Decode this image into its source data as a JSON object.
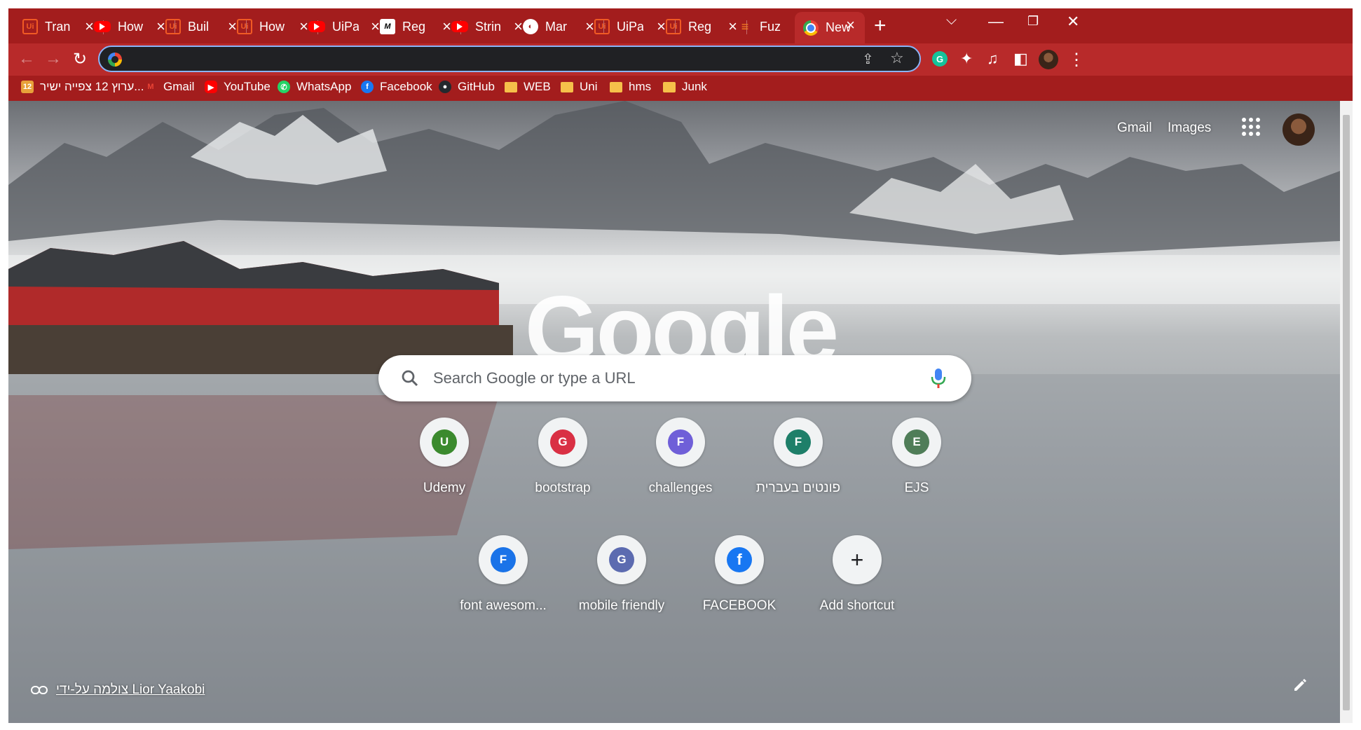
{
  "tabs": [
    {
      "title": "Tran",
      "icon": "uipath-icon",
      "glyph": "Ui"
    },
    {
      "title": "How",
      "icon": "youtube-icon",
      "glyph": ""
    },
    {
      "title": "Buil",
      "icon": "uipath-icon",
      "glyph": "Ui"
    },
    {
      "title": "How",
      "icon": "uipath-icon",
      "glyph": "Ui"
    },
    {
      "title": "UiPa",
      "icon": "youtube-icon",
      "glyph": ""
    },
    {
      "title": "Reg",
      "icon": "medium-icon",
      "glyph": "M"
    },
    {
      "title": "Strin",
      "icon": "youtube-icon",
      "glyph": ""
    },
    {
      "title": "Mar",
      "icon": "globe-icon",
      "glyph": "◐"
    },
    {
      "title": "UiPa",
      "icon": "uipath-icon",
      "glyph": "Ui"
    },
    {
      "title": "Reg",
      "icon": "uipath-icon",
      "glyph": "Ui"
    },
    {
      "title": "Fuz",
      "icon": "stackoverflow-icon",
      "glyph": "≡"
    },
    {
      "title": "New",
      "icon": "chrome-icon",
      "glyph": "",
      "active": true
    }
  ],
  "window": {
    "new_tab": "+",
    "tab_search": "⌵",
    "minimize": "—",
    "restore": "❐",
    "close": "✕"
  },
  "toolbar": {
    "back": "←",
    "forward": "→",
    "reload": "↻",
    "address_value": "",
    "share": "⇪",
    "star": "☆",
    "grammarly": "G",
    "extensions": "✦",
    "media": "♫",
    "sidepanel": "◧",
    "menu": "⋮"
  },
  "bookmarks": [
    {
      "label": "ערוץ 12 צפייה ישיר...",
      "icon": "channel12-icon",
      "glyph": "12",
      "color": "#e8a13a"
    },
    {
      "label": "Gmail",
      "icon": "gmail-icon",
      "glyph": "M",
      "color": "#ea4335"
    },
    {
      "label": "YouTube",
      "icon": "youtube-icon",
      "glyph": "▶",
      "color": "#ff0000"
    },
    {
      "label": "WhatsApp",
      "icon": "whatsapp-icon",
      "glyph": "✆",
      "color": "#25d366"
    },
    {
      "label": "Facebook",
      "icon": "facebook-icon",
      "glyph": "f",
      "color": "#1877f2"
    },
    {
      "label": "GitHub",
      "icon": "github-icon",
      "glyph": "●",
      "color": "#24292e"
    },
    {
      "label": "WEB",
      "icon": "folder-icon",
      "glyph": "",
      "color": "#f6c04a"
    },
    {
      "label": "Uni",
      "icon": "folder-icon",
      "glyph": "",
      "color": "#f6c04a"
    },
    {
      "label": "hms",
      "icon": "folder-icon",
      "glyph": "",
      "color": "#f6c04a"
    },
    {
      "label": "Junk",
      "icon": "folder-icon",
      "glyph": "",
      "color": "#f6c04a"
    }
  ],
  "ntp": {
    "gmail": "Gmail",
    "images": "Images",
    "logo": "Google",
    "search_placeholder": "Search Google or type a URL",
    "credit": "צולמה על-ידי Lior Yaakobi",
    "shortcuts": [
      {
        "label": "Udemy",
        "letter": "U",
        "color": "#3b8a2e"
      },
      {
        "label": "bootstrap",
        "letter": "G",
        "color": "#d93044"
      },
      {
        "label": "challenges",
        "letter": "F",
        "color": "#6f5fd8"
      },
      {
        "label": "פונטים בעברית",
        "letter": "F",
        "color": "#1e7f69"
      },
      {
        "label": "EJS",
        "letter": "E",
        "color": "#4f7d58"
      },
      {
        "label": "font awesom...",
        "letter": "F",
        "color": "#1a73e8"
      },
      {
        "label": "mobile friendly",
        "letter": "G",
        "color": "#5c6bb0"
      },
      {
        "label": "FACEBOOK",
        "letter": "f",
        "color": "#1877f2"
      },
      {
        "label": "Add shortcut",
        "letter": "+",
        "color": "#f1f3f4"
      }
    ]
  },
  "colors": {
    "frame": "#a31d1d",
    "toolbar": "#b82a2a",
    "omnibox": "#202124",
    "focus": "#8ab4f8"
  }
}
